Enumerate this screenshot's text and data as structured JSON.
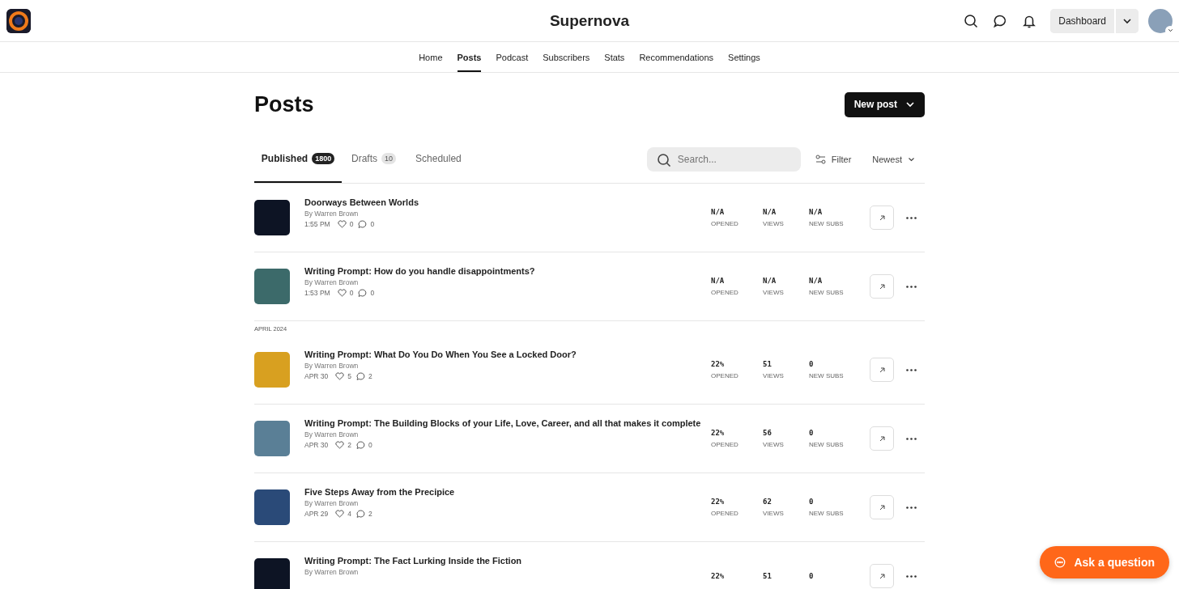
{
  "header": {
    "title": "Supernova",
    "dashboard": "Dashboard"
  },
  "nav": [
    {
      "label": "Home",
      "selected": false
    },
    {
      "label": "Posts",
      "selected": true
    },
    {
      "label": "Podcast",
      "selected": false
    },
    {
      "label": "Subscribers",
      "selected": false
    },
    {
      "label": "Stats",
      "selected": false
    },
    {
      "label": "Recommendations",
      "selected": false
    },
    {
      "label": "Settings",
      "selected": false
    }
  ],
  "page_title": "Posts",
  "new_post": "New post",
  "tabs": [
    {
      "label": "Published",
      "count": "1800",
      "selected": true
    },
    {
      "label": "Drafts",
      "count": "10",
      "selected": false
    },
    {
      "label": "Scheduled",
      "selected": false
    }
  ],
  "search": {
    "placeholder": "Search..."
  },
  "filter": "Filter",
  "sort": "Newest",
  "posts": [
    {
      "kind": "post",
      "title": "Doorways Between Worlds",
      "byline": "By Warren Brown",
      "time": "1:55 PM",
      "likes": "0",
      "comments": "0",
      "stats": [
        {
          "value": "N/A",
          "label": "OPENED"
        },
        {
          "value": "N/A",
          "label": "VIEWS"
        },
        {
          "value": "N/A",
          "label": "NEW SUBS"
        }
      ]
    },
    {
      "kind": "post",
      "title": "Writing Prompt: How do you handle disappointments?",
      "byline": "By Warren Brown",
      "time": "1:53 PM",
      "likes": "0",
      "comments": "0",
      "stats": [
        {
          "value": "N/A",
          "label": "OPENED"
        },
        {
          "value": "N/A",
          "label": "VIEWS"
        },
        {
          "value": "N/A",
          "label": "NEW SUBS"
        }
      ]
    },
    {
      "kind": "group",
      "label": "APRIL 2024"
    },
    {
      "kind": "post",
      "title": "Writing Prompt: What Do You Do When You See a Locked Door?",
      "byline": "By Warren Brown",
      "time": "APR 30",
      "likes": "5",
      "comments": "2",
      "stats": [
        {
          "value": "22%",
          "label": "OPENED"
        },
        {
          "value": "51",
          "label": "VIEWS"
        },
        {
          "value": "0",
          "label": "NEW SUBS"
        }
      ]
    },
    {
      "kind": "post",
      "title": "Writing Prompt: The Building Blocks of your Life, Love, Career, and all that makes it complete",
      "byline": "By Warren Brown",
      "time": "APR 30",
      "likes": "2",
      "comments": "0",
      "stats": [
        {
          "value": "22%",
          "label": "OPENED"
        },
        {
          "value": "56",
          "label": "VIEWS"
        },
        {
          "value": "0",
          "label": "NEW SUBS"
        }
      ]
    },
    {
      "kind": "post",
      "title": "Five Steps Away from the Precipice",
      "byline": "By Warren Brown",
      "time": "APR 29",
      "likes": "4",
      "comments": "2",
      "stats": [
        {
          "value": "22%",
          "label": "OPENED"
        },
        {
          "value": "62",
          "label": "VIEWS"
        },
        {
          "value": "0",
          "label": "NEW SUBS"
        }
      ]
    },
    {
      "kind": "post",
      "title": "Writing Prompt: The Fact Lurking Inside the Fiction",
      "byline": "By Warren Brown",
      "stats": [
        {
          "value": "22%"
        },
        {
          "value": "51"
        },
        {
          "value": "0"
        }
      ]
    }
  ],
  "ask": "Ask a question"
}
